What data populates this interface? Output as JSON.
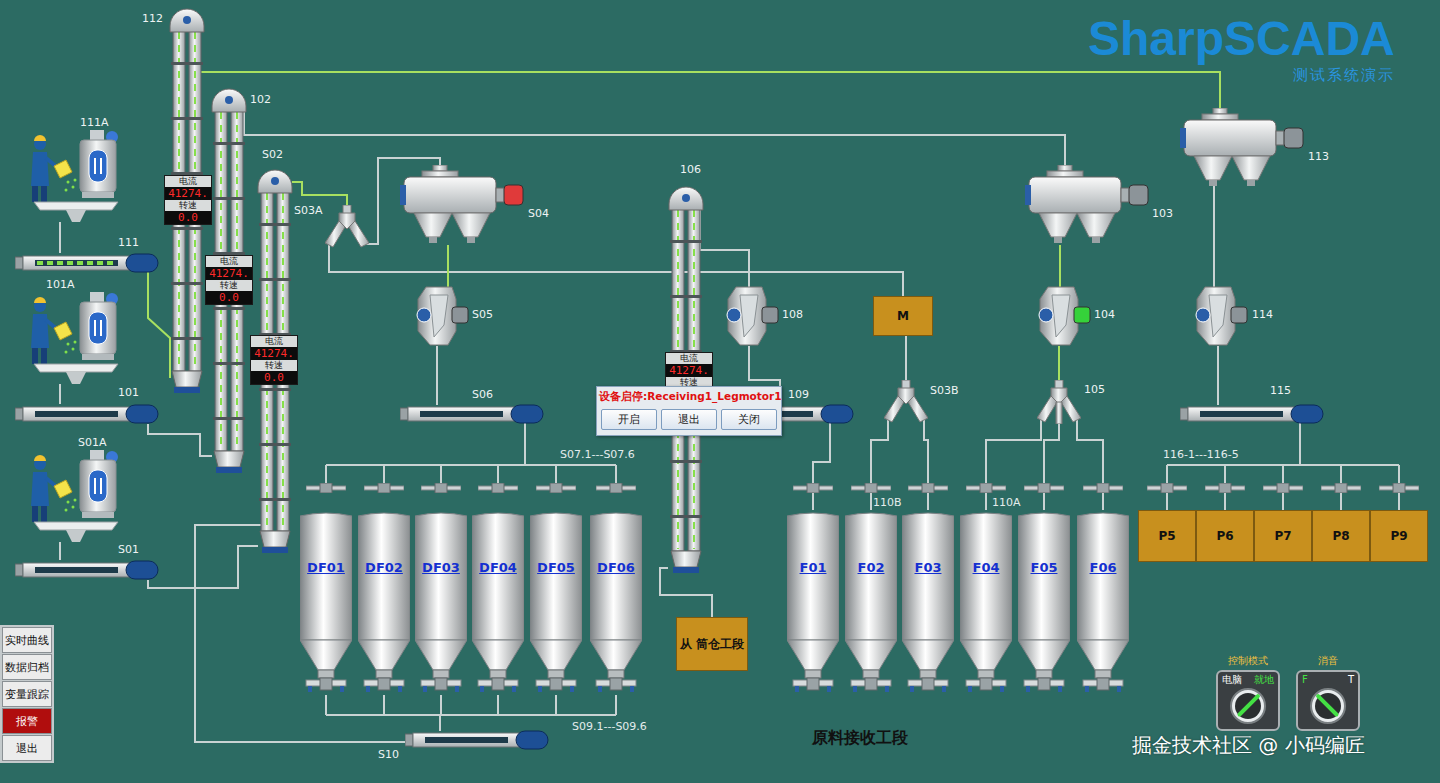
{
  "logo": {
    "title": "SharpSCADA",
    "subtitle": "测试系统演示"
  },
  "elevators": [
    {
      "label": "112",
      "running": true,
      "gauge": {
        "current_label": "电流",
        "current": "41274.",
        "speed_label": "转速",
        "speed": "0.0"
      }
    },
    {
      "label": "102",
      "running": true,
      "gauge": {
        "current_label": "电流",
        "current": "41274.",
        "speed_label": "转速",
        "speed": "0.0"
      }
    },
    {
      "label": "S02",
      "running": true,
      "gauge": {
        "current_label": "电流",
        "current": "41274.",
        "speed_label": "转速",
        "speed": "0.0"
      }
    },
    {
      "label": "106",
      "running": true,
      "gauge": {
        "current_label": "电流",
        "current": "41274.",
        "speed_label": "转速",
        "speed": ""
      }
    }
  ],
  "mixers": [
    {
      "label": "111A"
    },
    {
      "label": "101A"
    },
    {
      "label": "S01A"
    }
  ],
  "conveyors": [
    {
      "label": "111",
      "running": true
    },
    {
      "label": "101",
      "running": false
    },
    {
      "label": "S01",
      "running": false
    },
    {
      "label": "S06",
      "running": false
    },
    {
      "label": "109",
      "running": false
    },
    {
      "label": "115",
      "running": false
    },
    {
      "label": "S10",
      "running": false
    }
  ],
  "filters": [
    {
      "label": "S04",
      "color": "#e03a3a"
    },
    {
      "label": "103",
      "color": "#8c9499"
    },
    {
      "label": "113",
      "color": "#8c9499"
    }
  ],
  "valves": [
    {
      "label": "S05",
      "color": "#8c9499"
    },
    {
      "label": "108",
      "color": "#8c9499"
    },
    {
      "label": "104",
      "color": "#35d23a"
    },
    {
      "label": "114",
      "color": "#8c9499"
    }
  ],
  "distributors": [
    {
      "label": "S03A",
      "kind": "two-way"
    },
    {
      "label": "S03B",
      "kind": "two-way"
    },
    {
      "label": "105",
      "kind": "three-way"
    }
  ],
  "df_silos": [
    {
      "label": "DF01"
    },
    {
      "label": "DF02"
    },
    {
      "label": "DF03"
    },
    {
      "label": "DF04"
    },
    {
      "label": "DF05"
    },
    {
      "label": "DF06"
    }
  ],
  "f_silos": [
    {
      "label": "F01"
    },
    {
      "label": "F02"
    },
    {
      "label": "F03"
    },
    {
      "label": "F04"
    },
    {
      "label": "F05"
    },
    {
      "label": "F06"
    }
  ],
  "products": [
    {
      "label": "P5"
    },
    {
      "label": "P6"
    },
    {
      "label": "P7"
    },
    {
      "label": "P8"
    },
    {
      "label": "P9"
    }
  ],
  "boxes": [
    {
      "label": "M"
    },
    {
      "label": "从 筒仓工段"
    }
  ],
  "notes": [
    "S07.1---S07.6",
    "S09.1---S09.6",
    "110B",
    "110A",
    "116-1---116-5"
  ],
  "section_title": "原料接收工段",
  "dialog": {
    "title": "设备启停:Receiving1_Legmotor1",
    "buttons": [
      "开启",
      "退出",
      "关闭"
    ]
  },
  "menu": [
    {
      "label": "实时曲线",
      "kind": "normal"
    },
    {
      "label": "数据归档",
      "kind": "normal"
    },
    {
      "label": "变量跟踪",
      "kind": "normal"
    },
    {
      "label": "报警",
      "kind": "alarm"
    },
    {
      "label": "退出",
      "kind": "normal"
    }
  ],
  "knobs": [
    {
      "title": "控制模式",
      "options": [
        {
          "label": "电脑",
          "selected": false
        },
        {
          "label": "就地",
          "selected": true
        }
      ]
    },
    {
      "title": "消音",
      "options": [
        {
          "label": "F",
          "selected": true
        },
        {
          "label": "T",
          "selected": false
        }
      ]
    }
  ],
  "watermark": "掘金技术社区 @ 小码编匠",
  "pipes": [
    {
      "active": true
    },
    {
      "active": true
    },
    {
      "active": false
    },
    {
      "active": true
    },
    {
      "active": false
    },
    {
      "active": false
    },
    {
      "active": true
    },
    {
      "active": false
    },
    {
      "active": false
    },
    {
      "active": false
    },
    {
      "active": false
    },
    {
      "active": false
    },
    {
      "active": false
    },
    {
      "active": false
    },
    {
      "active": true
    },
    {
      "active": true
    },
    {
      "active": false
    },
    {
      "active": false
    },
    {
      "active": false
    },
    {
      "active": false
    },
    {
      "active": false
    },
    {
      "active": false
    },
    {
      "active": false
    },
    {
      "active": false
    },
    {
      "active": false
    },
    {
      "active": false
    }
  ]
}
